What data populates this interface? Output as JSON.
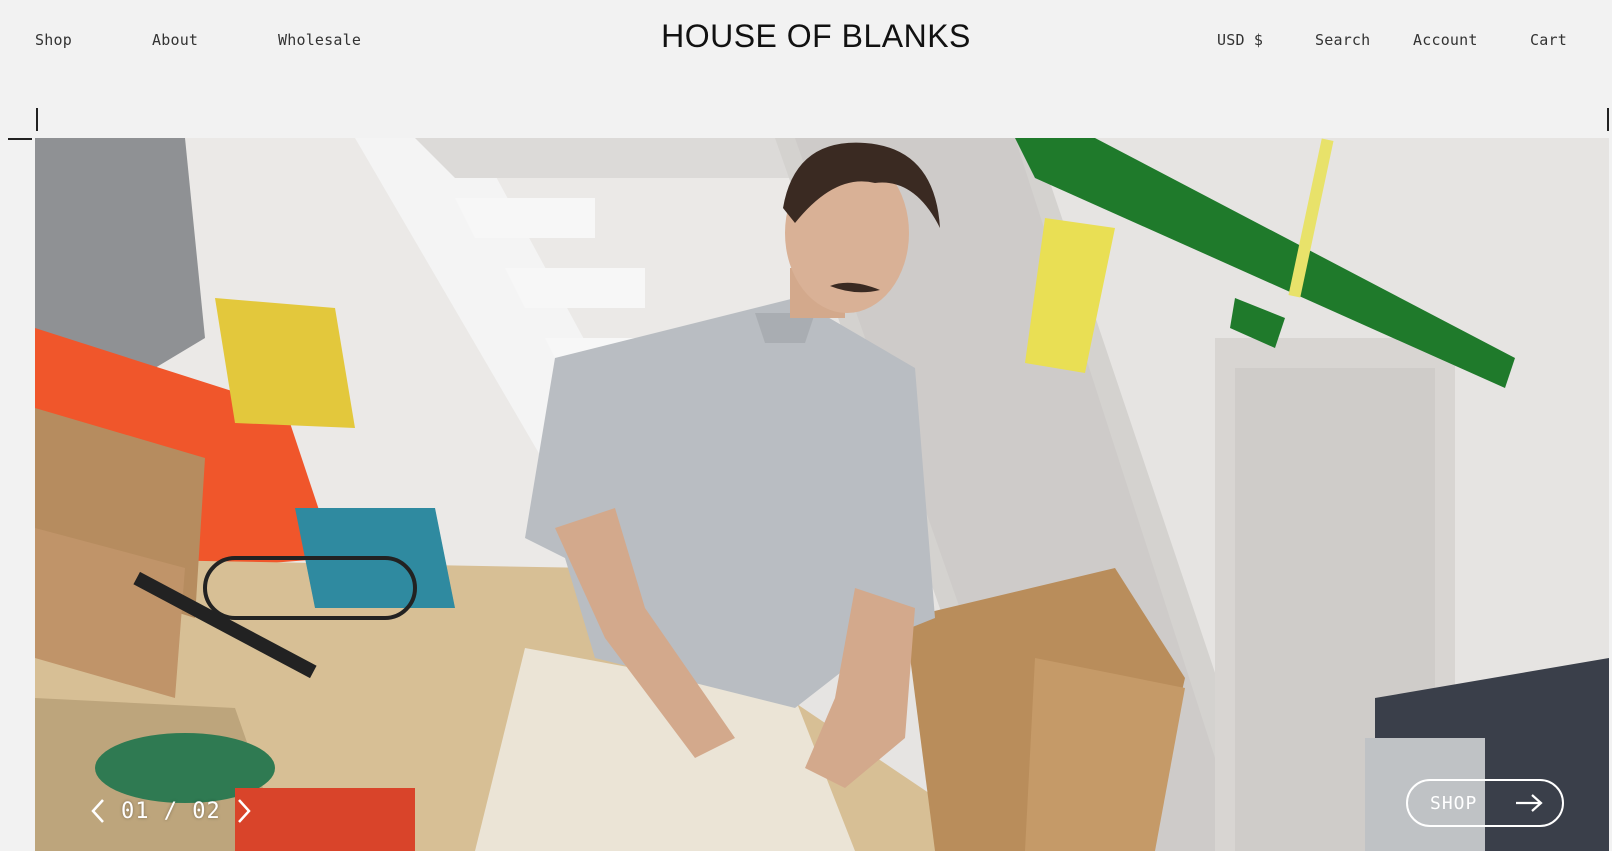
{
  "header": {
    "nav_left": [
      "Shop",
      "About",
      "Wholesale"
    ],
    "brand": "HOUSE OF BLANKS",
    "nav_right": {
      "currency": "USD $",
      "search": "Search",
      "account": "Account",
      "cart": "Cart"
    }
  },
  "hero": {
    "slide_counter": "01 / 02",
    "cta_label": "SHOP",
    "prev_icon": "chevron-left-icon",
    "next_icon": "chevron-right-icon",
    "cta_icon": "arrow-right-icon"
  },
  "colors": {
    "background": "#f2f2f2",
    "text": "#222222",
    "accent_green": "#1f7a2b",
    "crate_orange": "#f0562b"
  }
}
